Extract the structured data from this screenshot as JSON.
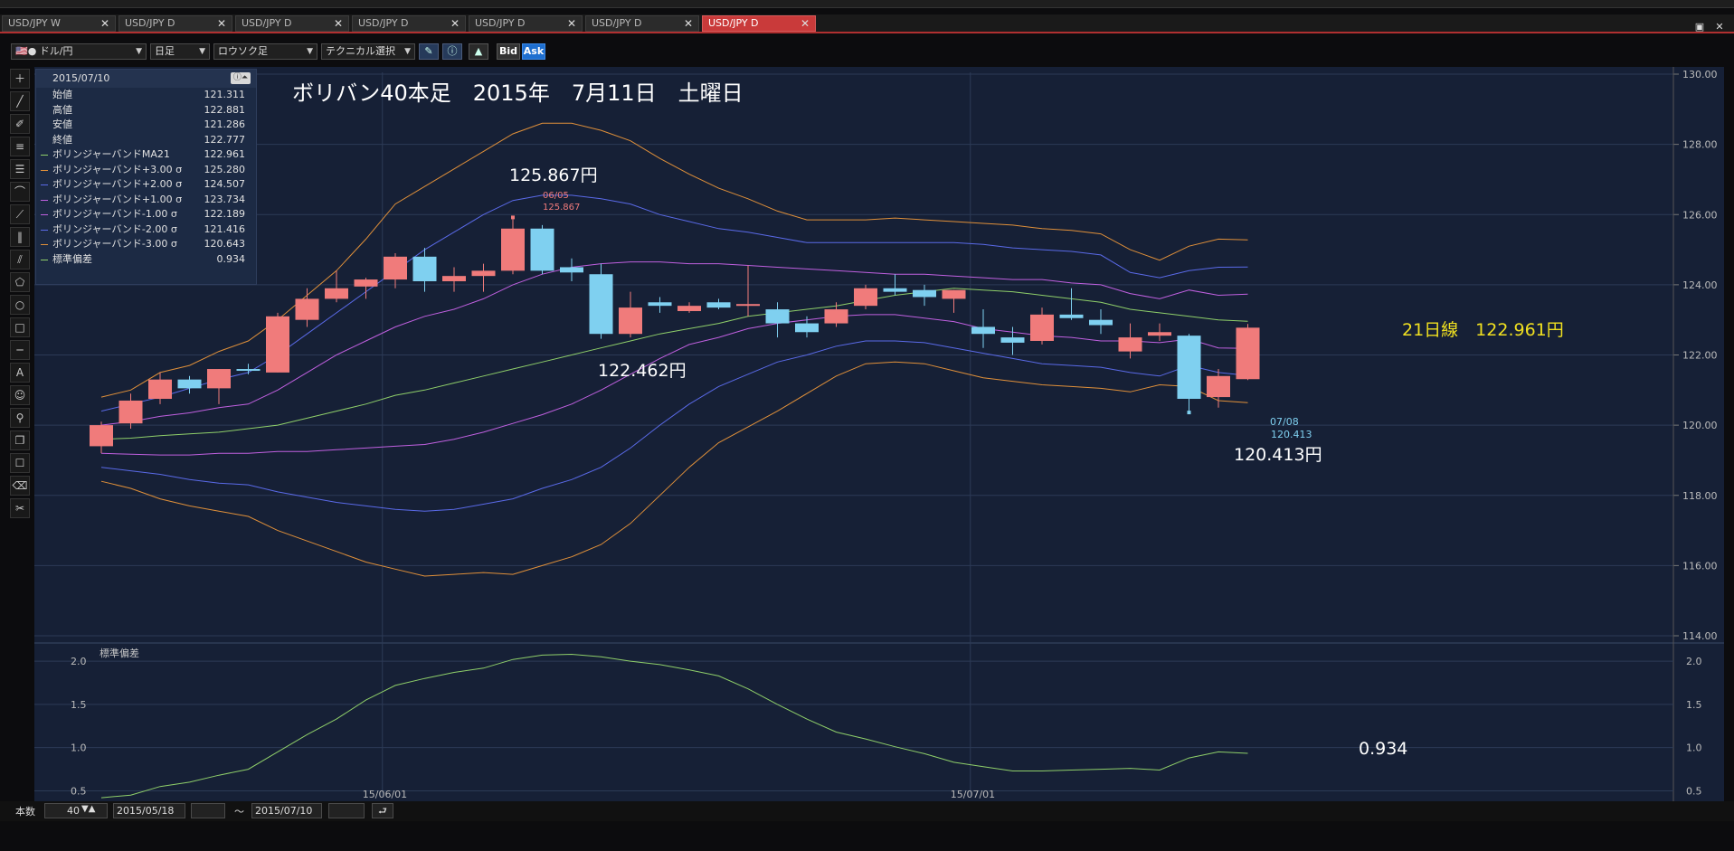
{
  "tabs": [
    {
      "label": "USD/JPY W",
      "active": false
    },
    {
      "label": "USD/JPY D",
      "active": false
    },
    {
      "label": "USD/JPY D",
      "active": false
    },
    {
      "label": "USD/JPY D",
      "active": false
    },
    {
      "label": "USD/JPY D",
      "active": false
    },
    {
      "label": "USD/JPY D",
      "active": false
    },
    {
      "label": "USD/JPY D",
      "active": true
    }
  ],
  "toolbar": {
    "currency_pair": "ドル/円",
    "period": "日足",
    "chart_style": "ロウソク足",
    "technical_select": "テクニカル選択",
    "bid_label": "Bid",
    "ask_label": "Ask"
  },
  "info_panel": {
    "date": "2015/07/10",
    "rows": [
      {
        "label": "始値",
        "value": "121.311",
        "color": ""
      },
      {
        "label": "高値",
        "value": "122.881",
        "color": ""
      },
      {
        "label": "安値",
        "value": "121.286",
        "color": ""
      },
      {
        "label": "終値",
        "value": "122.777",
        "color": ""
      },
      {
        "label": "ボリンジャーバンドMA21",
        "value": "122.961",
        "color": "#8fcf6a"
      },
      {
        "label": "ボリンジャーバンド+3.00 σ",
        "value": "125.280",
        "color": "#e0903a"
      },
      {
        "label": "ボリンジャーバンド+2.00 σ",
        "value": "124.507",
        "color": "#5a6ae8"
      },
      {
        "label": "ボリンジャーバンド+1.00 σ",
        "value": "123.734",
        "color": "#c060e0"
      },
      {
        "label": "ボリンジャーバンド-1.00 σ",
        "value": "122.189",
        "color": "#c060e0"
      },
      {
        "label": "ボリンジャーバンド-2.00 σ",
        "value": "121.416",
        "color": "#5a6ae8"
      },
      {
        "label": "ボリンジャーバンド-3.00 σ",
        "value": "120.643",
        "color": "#e0903a"
      },
      {
        "label": "標準偏差",
        "value": "0.934",
        "color": "#8fcf6a"
      }
    ]
  },
  "annotations": {
    "title": "ボリバン40本足　2015年　7月11日　土曜日",
    "high_price": "125.867円",
    "high_marker_date": "06/05",
    "high_marker_value": "125.867",
    "mid_price": "122.462円",
    "low_price": "120.413円",
    "low_marker_date": "07/08",
    "low_marker_value": "120.413",
    "ma_label": "21日線　122.961円",
    "stddev_value": "0.934",
    "stddev_panel_label": "標準偏差"
  },
  "chart_data": {
    "type": "candlestick",
    "instrument": "USD/JPY D",
    "ylim": [
      114,
      130
    ],
    "yticks": [
      "114.00",
      "116.00",
      "118.00",
      "120.00",
      "122.00",
      "124.00",
      "126.00",
      "128.00",
      "130.00"
    ],
    "xtick_labels": [
      "15/06/01",
      "15/07/01"
    ],
    "candles": [
      {
        "o": 119.4,
        "h": 120.1,
        "l": 119.2,
        "c": 120.0
      },
      {
        "o": 120.05,
        "h": 120.9,
        "l": 119.9,
        "c": 120.7
      },
      {
        "o": 120.75,
        "h": 121.5,
        "l": 120.6,
        "c": 121.3
      },
      {
        "o": 121.3,
        "h": 121.4,
        "l": 120.9,
        "c": 121.05
      },
      {
        "o": 121.05,
        "h": 121.6,
        "l": 120.6,
        "c": 121.6
      },
      {
        "o": 121.6,
        "h": 121.75,
        "l": 121.45,
        "c": 121.55
      },
      {
        "o": 121.5,
        "h": 123.2,
        "l": 121.5,
        "c": 123.1
      },
      {
        "o": 123.0,
        "h": 123.9,
        "l": 122.8,
        "c": 123.6
      },
      {
        "o": 123.6,
        "h": 124.4,
        "l": 123.5,
        "c": 123.9
      },
      {
        "o": 123.95,
        "h": 124.2,
        "l": 123.6,
        "c": 124.15
      },
      {
        "o": 124.15,
        "h": 124.9,
        "l": 123.9,
        "c": 124.8
      },
      {
        "o": 124.8,
        "h": 125.05,
        "l": 123.8,
        "c": 124.1
      },
      {
        "o": 124.1,
        "h": 124.5,
        "l": 123.8,
        "c": 124.25
      },
      {
        "o": 124.25,
        "h": 124.6,
        "l": 123.8,
        "c": 124.4
      },
      {
        "o": 124.4,
        "h": 125.867,
        "l": 124.3,
        "c": 125.6
      },
      {
        "o": 125.6,
        "h": 125.7,
        "l": 124.3,
        "c": 124.4
      },
      {
        "o": 124.5,
        "h": 124.75,
        "l": 124.1,
        "c": 124.35
      },
      {
        "o": 124.3,
        "h": 124.6,
        "l": 122.462,
        "c": 122.6
      },
      {
        "o": 122.6,
        "h": 123.8,
        "l": 122.5,
        "c": 123.35
      },
      {
        "o": 123.5,
        "h": 123.65,
        "l": 123.2,
        "c": 123.4
      },
      {
        "o": 123.25,
        "h": 123.5,
        "l": 123.2,
        "c": 123.4
      },
      {
        "o": 123.5,
        "h": 123.6,
        "l": 123.3,
        "c": 123.35
      },
      {
        "o": 123.4,
        "h": 124.55,
        "l": 123.1,
        "c": 123.45
      },
      {
        "o": 123.3,
        "h": 123.5,
        "l": 122.5,
        "c": 122.9
      },
      {
        "o": 122.9,
        "h": 123.1,
        "l": 122.5,
        "c": 122.65
      },
      {
        "o": 122.9,
        "h": 123.5,
        "l": 122.8,
        "c": 123.3
      },
      {
        "o": 123.4,
        "h": 124.0,
        "l": 123.3,
        "c": 123.9
      },
      {
        "o": 123.9,
        "h": 124.3,
        "l": 123.7,
        "c": 123.8
      },
      {
        "o": 123.85,
        "h": 124.0,
        "l": 123.4,
        "c": 123.65
      },
      {
        "o": 123.6,
        "h": 123.85,
        "l": 123.2,
        "c": 123.85
      },
      {
        "o": 122.8,
        "h": 123.3,
        "l": 122.2,
        "c": 122.6
      },
      {
        "o": 122.5,
        "h": 122.8,
        "l": 122.0,
        "c": 122.35
      },
      {
        "o": 122.4,
        "h": 123.35,
        "l": 122.3,
        "c": 123.15
      },
      {
        "o": 123.15,
        "h": 123.9,
        "l": 123.0,
        "c": 123.05
      },
      {
        "o": 123.0,
        "h": 123.3,
        "l": 122.6,
        "c": 122.85
      },
      {
        "o": 122.1,
        "h": 122.9,
        "l": 121.9,
        "c": 122.5
      },
      {
        "o": 122.55,
        "h": 122.9,
        "l": 122.4,
        "c": 122.65
      },
      {
        "o": 122.55,
        "h": 122.6,
        "l": 120.413,
        "c": 120.75
      },
      {
        "o": 120.8,
        "h": 121.6,
        "l": 120.5,
        "c": 121.4
      },
      {
        "o": 121.311,
        "h": 122.881,
        "l": 121.286,
        "c": 122.777
      }
    ],
    "bollinger": {
      "ma21": [
        119.6,
        119.63,
        119.7,
        119.75,
        119.8,
        119.9,
        120.0,
        120.2,
        120.4,
        120.6,
        120.85,
        121.0,
        121.2,
        121.4,
        121.6,
        121.8,
        122.0,
        122.2,
        122.4,
        122.6,
        122.75,
        122.9,
        123.1,
        123.2,
        123.3,
        123.4,
        123.55,
        123.7,
        123.8,
        123.9,
        123.85,
        123.8,
        123.7,
        123.6,
        123.5,
        123.3,
        123.2,
        123.1,
        123.0,
        122.961
      ],
      "plus1": [
        119.2,
        119.17,
        119.15,
        119.15,
        119.2,
        119.2,
        119.25,
        119.25,
        119.3,
        119.35,
        119.4,
        119.45,
        119.6,
        119.8,
        120.05,
        120.3,
        120.6,
        121.0,
        121.45,
        121.9,
        122.3,
        122.5,
        122.75,
        122.9,
        123.0,
        123.1,
        123.15,
        123.15,
        123.05,
        122.95,
        122.75,
        122.65,
        122.55,
        122.5,
        122.4,
        122.4,
        122.35,
        122.45,
        122.2,
        122.189
      ],
      "plus2": [
        118.8,
        118.7,
        118.6,
        118.45,
        118.35,
        118.3,
        118.1,
        117.95,
        117.8,
        117.7,
        117.6,
        117.55,
        117.6,
        117.75,
        117.9,
        118.2,
        118.45,
        118.8,
        119.35,
        120.0,
        120.6,
        121.1,
        121.45,
        121.8,
        122.0,
        122.25,
        122.4,
        122.4,
        122.35,
        122.2,
        122.05,
        121.9,
        121.75,
        121.7,
        121.65,
        121.5,
        121.4,
        121.7,
        121.5,
        121.416
      ],
      "plus3": [
        118.4,
        118.2,
        117.9,
        117.7,
        117.55,
        117.4,
        117.0,
        116.7,
        116.4,
        116.1,
        115.9,
        115.7,
        115.75,
        115.8,
        115.75,
        116.0,
        116.25,
        116.6,
        117.2,
        118.0,
        118.8,
        119.5,
        119.95,
        120.4,
        120.9,
        121.4,
        121.75,
        121.8,
        121.75,
        121.55,
        121.35,
        121.25,
        121.15,
        121.1,
        121.05,
        120.95,
        121.15,
        121.1,
        120.7,
        120.643
      ],
      "upper1": [
        120.0,
        120.1,
        120.25,
        120.35,
        120.5,
        120.6,
        121.0,
        121.5,
        122.0,
        122.4,
        122.8,
        123.1,
        123.3,
        123.6,
        124.0,
        124.3,
        124.5,
        124.6,
        124.65,
        124.65,
        124.6,
        124.6,
        124.55,
        124.5,
        124.45,
        124.4,
        124.35,
        124.3,
        124.3,
        124.25,
        124.2,
        124.15,
        124.15,
        124.05,
        124.0,
        123.75,
        123.6,
        123.85,
        123.7,
        123.734
      ],
      "upper2": [
        120.4,
        120.6,
        120.8,
        121.05,
        121.3,
        121.5,
        122.0,
        122.6,
        123.2,
        123.8,
        124.4,
        125.0,
        125.5,
        126.0,
        126.4,
        126.55,
        126.55,
        126.45,
        126.3,
        126.0,
        125.8,
        125.6,
        125.5,
        125.35,
        125.2,
        125.2,
        125.2,
        125.2,
        125.2,
        125.2,
        125.15,
        125.05,
        125.0,
        124.95,
        124.85,
        124.35,
        124.2,
        124.4,
        124.5,
        124.507
      ],
      "upper3": [
        120.8,
        121.0,
        121.5,
        121.7,
        122.1,
        122.4,
        123.0,
        123.7,
        124.4,
        125.3,
        126.3,
        126.8,
        127.3,
        127.8,
        128.3,
        128.6,
        128.6,
        128.4,
        128.1,
        127.6,
        127.15,
        126.75,
        126.45,
        126.1,
        125.85,
        125.85,
        125.85,
        125.9,
        125.85,
        125.8,
        125.75,
        125.7,
        125.6,
        125.55,
        125.45,
        125.0,
        124.7,
        125.1,
        125.3,
        125.28
      ]
    },
    "stddev": {
      "ylim": [
        0.4,
        2.2
      ],
      "yticks": [
        "0.5",
        "1.0",
        "1.5",
        "2.0"
      ],
      "values": [
        0.42,
        0.45,
        0.55,
        0.6,
        0.68,
        0.75,
        0.95,
        1.15,
        1.33,
        1.55,
        1.72,
        1.8,
        1.87,
        1.92,
        2.02,
        2.07,
        2.08,
        2.05,
        2.0,
        1.96,
        1.9,
        1.83,
        1.68,
        1.5,
        1.33,
        1.18,
        1.1,
        1.01,
        0.93,
        0.83,
        0.78,
        0.73,
        0.73,
        0.74,
        0.75,
        0.76,
        0.74,
        0.88,
        0.95,
        0.934
      ]
    }
  },
  "bottom": {
    "count_label": "本数",
    "count_value": "40",
    "start_date": "2015/05/18",
    "tilde": "～",
    "end_date": "2015/07/10"
  },
  "colors": {
    "up": "#f07b7b",
    "down": "#7fd0f0",
    "ma": "#8fcf6a",
    "sigma1": "#c060e0",
    "sigma2": "#5a6ae8",
    "sigma3": "#e0903a",
    "stddev": "#8fcf6a"
  }
}
